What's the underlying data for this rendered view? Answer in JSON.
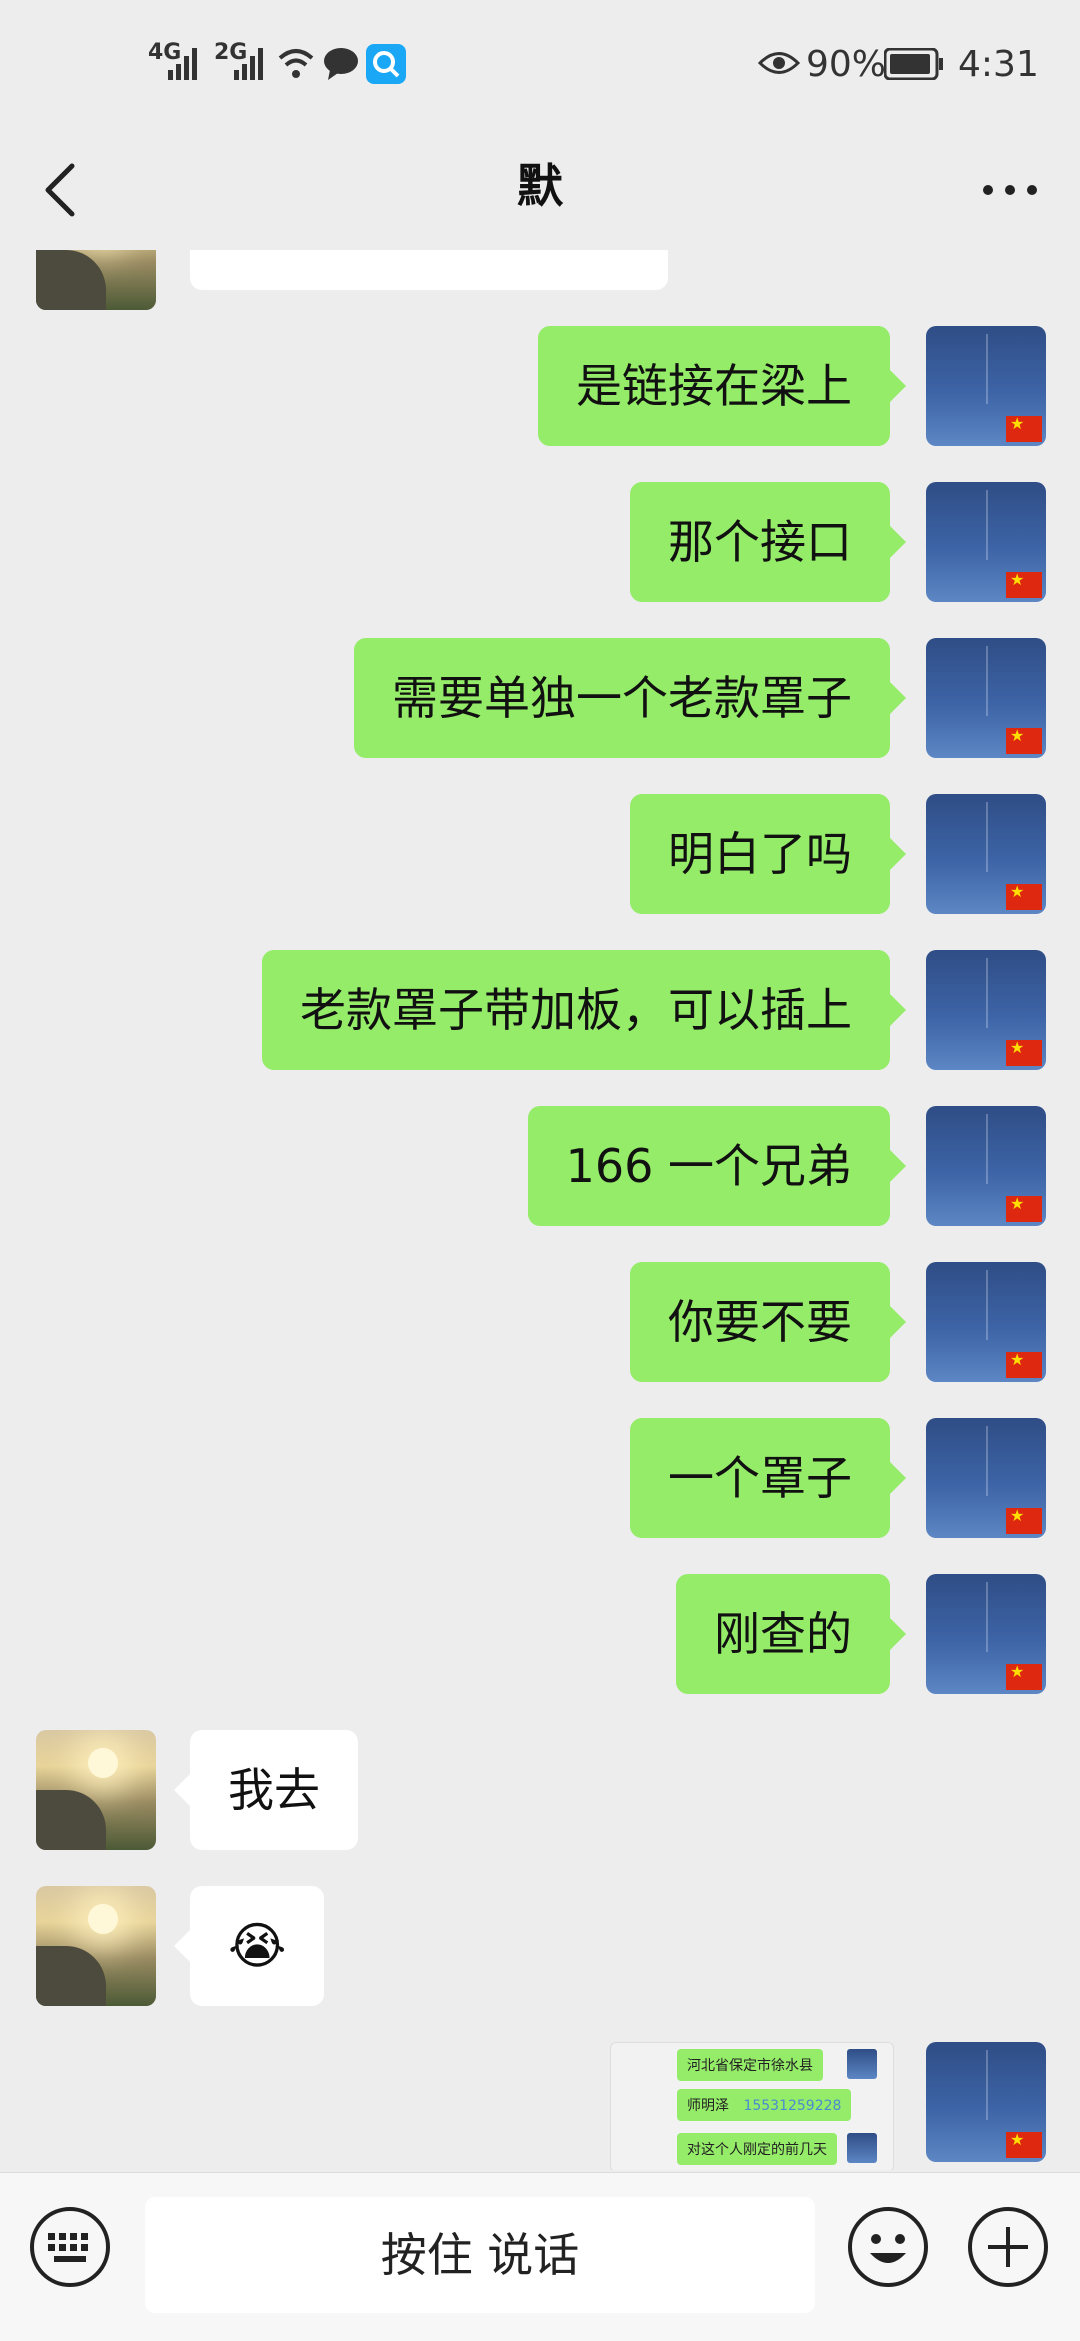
{
  "status_bar": {
    "signal1": "4G",
    "signal2": "2G",
    "battery": "90%",
    "time": "4:31"
  },
  "header": {
    "title": "默"
  },
  "messages": [
    {
      "side": "right",
      "text": "是链接在梁上"
    },
    {
      "side": "right",
      "text": "那个接口"
    },
    {
      "side": "right",
      "text": "需要单独一个老款罩子"
    },
    {
      "side": "right",
      "text": "明白了吗"
    },
    {
      "side": "right",
      "text": "老款罩子带加板，可以插上"
    },
    {
      "side": "right",
      "text": "166 一个兄弟"
    },
    {
      "side": "right",
      "text": "你要不要"
    },
    {
      "side": "right",
      "text": "一个罩子"
    },
    {
      "side": "right",
      "text": "刚查的"
    },
    {
      "side": "left",
      "text": "我去"
    },
    {
      "side": "left",
      "text": "😭"
    }
  ],
  "image_message": {
    "line1": "河北省保定市徐水县",
    "line2_name": "师明泽",
    "line2_phone": "15531259228",
    "line3": "对这个人刚定的前几天"
  },
  "input_bar": {
    "voice_label": "按住 说话"
  },
  "icons": [
    "back-icon",
    "more-icon",
    "keyboard-icon",
    "emoji-icon",
    "plus-icon",
    "eye-icon",
    "wifi-icon",
    "message-icon",
    "search-app-icon",
    "battery-icon"
  ]
}
